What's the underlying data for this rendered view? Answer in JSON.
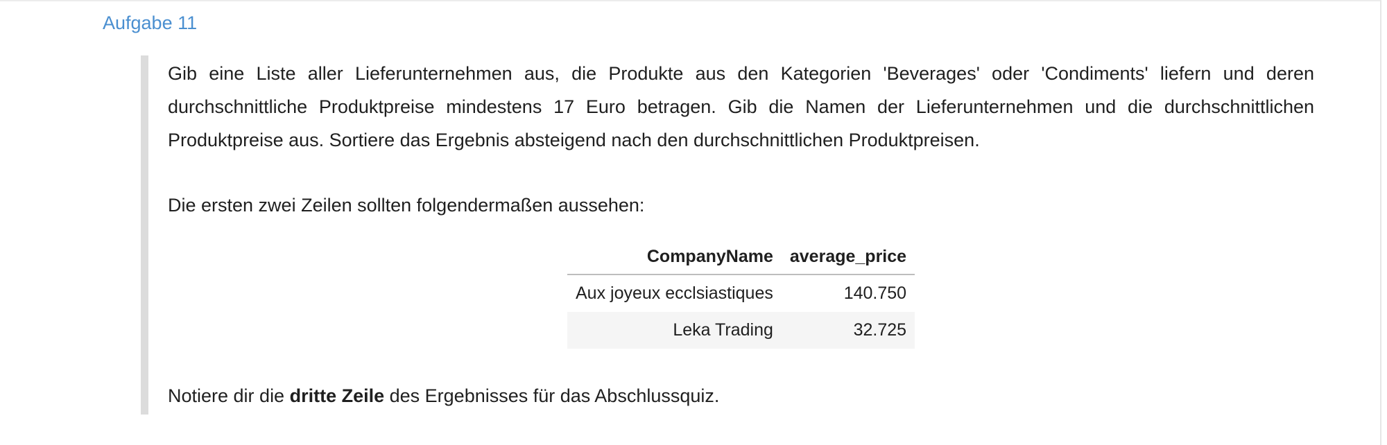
{
  "task": {
    "heading": "Aufgabe 11",
    "description": "Gib eine Liste aller Lieferunternehmen aus, die Produkte aus den Kategorien 'Beverages' oder 'Condiments' liefern und deren durchschnittliche Produktpreise mindestens 17 Euro betragen. Gib die Namen der Lieferunternehmen und die durchschnittlichen Produktpreise aus. Sortiere das Ergebnis absteigend nach den durchschnittlichen Produktpreisen.",
    "intro": "Die ersten zwei Zeilen sollten folgendermaßen aussehen:",
    "table": {
      "headers": [
        "CompanyName",
        "average_price"
      ],
      "rows": [
        [
          "Aux joyeux ecclsiastiques",
          "140.750"
        ],
        [
          "Leka Trading",
          "32.725"
        ]
      ]
    },
    "outro": {
      "before": "Notiere dir die ",
      "bold": "dritte Zeile",
      "after": " des Ergebnisses für das Abschlussquiz."
    }
  }
}
